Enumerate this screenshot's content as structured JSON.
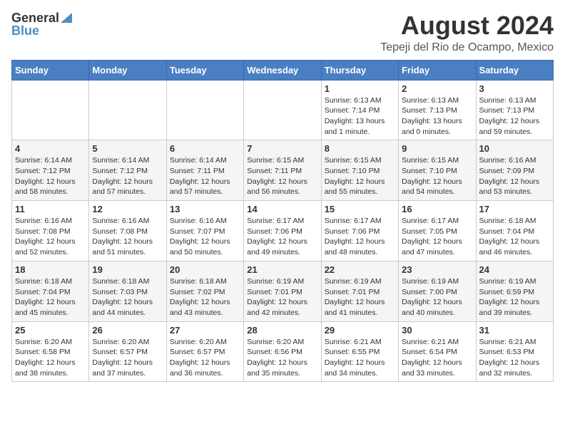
{
  "logo": {
    "general": "General",
    "blue": "Blue"
  },
  "title": "August 2024",
  "subtitle": "Tepeji del Rio de Ocampo, Mexico",
  "days_of_week": [
    "Sunday",
    "Monday",
    "Tuesday",
    "Wednesday",
    "Thursday",
    "Friday",
    "Saturday"
  ],
  "weeks": [
    [
      {
        "day": "",
        "info": ""
      },
      {
        "day": "",
        "info": ""
      },
      {
        "day": "",
        "info": ""
      },
      {
        "day": "",
        "info": ""
      },
      {
        "day": "1",
        "info": "Sunrise: 6:13 AM\nSunset: 7:14 PM\nDaylight: 13 hours\nand 1 minute."
      },
      {
        "day": "2",
        "info": "Sunrise: 6:13 AM\nSunset: 7:13 PM\nDaylight: 13 hours\nand 0 minutes."
      },
      {
        "day": "3",
        "info": "Sunrise: 6:13 AM\nSunset: 7:13 PM\nDaylight: 12 hours\nand 59 minutes."
      }
    ],
    [
      {
        "day": "4",
        "info": "Sunrise: 6:14 AM\nSunset: 7:12 PM\nDaylight: 12 hours\nand 58 minutes."
      },
      {
        "day": "5",
        "info": "Sunrise: 6:14 AM\nSunset: 7:12 PM\nDaylight: 12 hours\nand 57 minutes."
      },
      {
        "day": "6",
        "info": "Sunrise: 6:14 AM\nSunset: 7:11 PM\nDaylight: 12 hours\nand 57 minutes."
      },
      {
        "day": "7",
        "info": "Sunrise: 6:15 AM\nSunset: 7:11 PM\nDaylight: 12 hours\nand 56 minutes."
      },
      {
        "day": "8",
        "info": "Sunrise: 6:15 AM\nSunset: 7:10 PM\nDaylight: 12 hours\nand 55 minutes."
      },
      {
        "day": "9",
        "info": "Sunrise: 6:15 AM\nSunset: 7:10 PM\nDaylight: 12 hours\nand 54 minutes."
      },
      {
        "day": "10",
        "info": "Sunrise: 6:16 AM\nSunset: 7:09 PM\nDaylight: 12 hours\nand 53 minutes."
      }
    ],
    [
      {
        "day": "11",
        "info": "Sunrise: 6:16 AM\nSunset: 7:08 PM\nDaylight: 12 hours\nand 52 minutes."
      },
      {
        "day": "12",
        "info": "Sunrise: 6:16 AM\nSunset: 7:08 PM\nDaylight: 12 hours\nand 51 minutes."
      },
      {
        "day": "13",
        "info": "Sunrise: 6:16 AM\nSunset: 7:07 PM\nDaylight: 12 hours\nand 50 minutes."
      },
      {
        "day": "14",
        "info": "Sunrise: 6:17 AM\nSunset: 7:06 PM\nDaylight: 12 hours\nand 49 minutes."
      },
      {
        "day": "15",
        "info": "Sunrise: 6:17 AM\nSunset: 7:06 PM\nDaylight: 12 hours\nand 48 minutes."
      },
      {
        "day": "16",
        "info": "Sunrise: 6:17 AM\nSunset: 7:05 PM\nDaylight: 12 hours\nand 47 minutes."
      },
      {
        "day": "17",
        "info": "Sunrise: 6:18 AM\nSunset: 7:04 PM\nDaylight: 12 hours\nand 46 minutes."
      }
    ],
    [
      {
        "day": "18",
        "info": "Sunrise: 6:18 AM\nSunset: 7:04 PM\nDaylight: 12 hours\nand 45 minutes."
      },
      {
        "day": "19",
        "info": "Sunrise: 6:18 AM\nSunset: 7:03 PM\nDaylight: 12 hours\nand 44 minutes."
      },
      {
        "day": "20",
        "info": "Sunrise: 6:18 AM\nSunset: 7:02 PM\nDaylight: 12 hours\nand 43 minutes."
      },
      {
        "day": "21",
        "info": "Sunrise: 6:19 AM\nSunset: 7:01 PM\nDaylight: 12 hours\nand 42 minutes."
      },
      {
        "day": "22",
        "info": "Sunrise: 6:19 AM\nSunset: 7:01 PM\nDaylight: 12 hours\nand 41 minutes."
      },
      {
        "day": "23",
        "info": "Sunrise: 6:19 AM\nSunset: 7:00 PM\nDaylight: 12 hours\nand 40 minutes."
      },
      {
        "day": "24",
        "info": "Sunrise: 6:19 AM\nSunset: 6:59 PM\nDaylight: 12 hours\nand 39 minutes."
      }
    ],
    [
      {
        "day": "25",
        "info": "Sunrise: 6:20 AM\nSunset: 6:58 PM\nDaylight: 12 hours\nand 38 minutes."
      },
      {
        "day": "26",
        "info": "Sunrise: 6:20 AM\nSunset: 6:57 PM\nDaylight: 12 hours\nand 37 minutes."
      },
      {
        "day": "27",
        "info": "Sunrise: 6:20 AM\nSunset: 6:57 PM\nDaylight: 12 hours\nand 36 minutes."
      },
      {
        "day": "28",
        "info": "Sunrise: 6:20 AM\nSunset: 6:56 PM\nDaylight: 12 hours\nand 35 minutes."
      },
      {
        "day": "29",
        "info": "Sunrise: 6:21 AM\nSunset: 6:55 PM\nDaylight: 12 hours\nand 34 minutes."
      },
      {
        "day": "30",
        "info": "Sunrise: 6:21 AM\nSunset: 6:54 PM\nDaylight: 12 hours\nand 33 minutes."
      },
      {
        "day": "31",
        "info": "Sunrise: 6:21 AM\nSunset: 6:53 PM\nDaylight: 12 hours\nand 32 minutes."
      }
    ]
  ]
}
